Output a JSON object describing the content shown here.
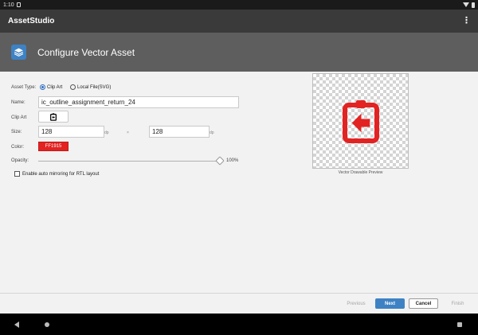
{
  "status_bar": {
    "time": "1:10"
  },
  "app_bar": {
    "title": "AssetStudio"
  },
  "banner": {
    "title": "Configure Vector Asset"
  },
  "form": {
    "asset_type_label": "Asset Type:",
    "radio_clip_art": "Clip Art",
    "radio_local_file": "Local File(SVG)",
    "selected_asset_type": "Clip Art",
    "name_label": "Name:",
    "name_value": "ic_outline_assignment_return_24",
    "clip_art_label": "Clip Art",
    "clip_art_icon": "assignment-return-icon",
    "size_label": "Size:",
    "width_value": "128",
    "height_value": "128",
    "unit": "dp",
    "times": "×",
    "color_label": "Color:",
    "color_value": "FF1915",
    "color_hex": "#e32222",
    "opacity_label": "Opacity:",
    "opacity_value": "100%",
    "opacity_fraction": 1.0,
    "auto_mirror_label": "Enable auto mirroring for RTL layout",
    "auto_mirror_checked": false
  },
  "preview": {
    "caption": "Vector Drawable Preview",
    "icon": "assignment-return-icon"
  },
  "footer": {
    "previous": "Previous",
    "next": "Next",
    "cancel": "Cancel",
    "finish": "Finish"
  },
  "colors": {
    "accent": "#3e82c4",
    "icon_red": "#e32222"
  }
}
